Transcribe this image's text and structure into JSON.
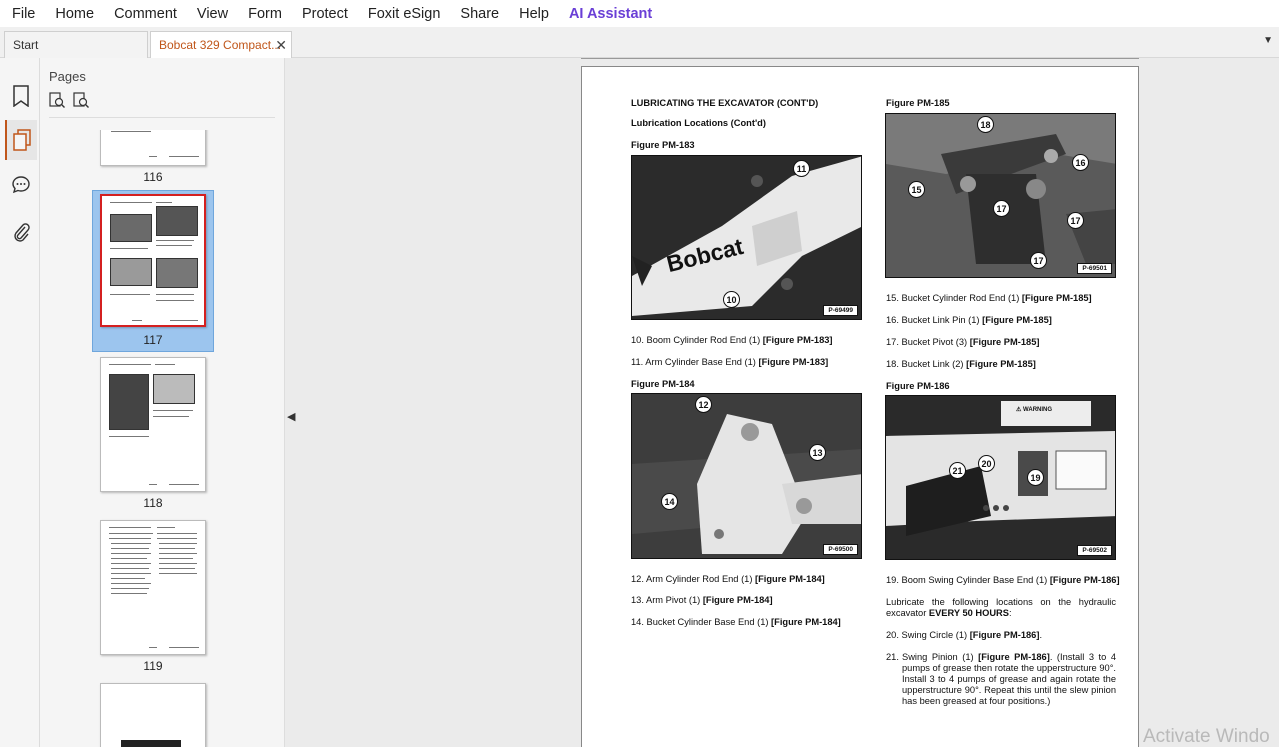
{
  "menu": [
    "File",
    "Home",
    "Comment",
    "View",
    "Form",
    "Protect",
    "Foxit eSign",
    "Share",
    "Help",
    "AI Assistant"
  ],
  "tabs": {
    "start": "Start",
    "document": "Bobcat 329 Compact..."
  },
  "panel": {
    "title": "Pages"
  },
  "thumbnails": [
    "116",
    "117",
    "118",
    "119"
  ],
  "page": {
    "heading": "LUBRICATING THE EXCAVATOR (CONT'D)",
    "subheading": "Lubrication Locations (Cont'd)",
    "fig183": {
      "caption": "Figure PM-183",
      "tag": "P-69499",
      "brand": "Bobcat"
    },
    "fig184": {
      "caption": "Figure PM-184",
      "tag": "P-69500"
    },
    "fig185": {
      "caption": "Figure PM-185",
      "tag": "P-69501"
    },
    "fig186": {
      "caption": "Figure PM-186",
      "tag": "P-69502",
      "warning": "⚠ WARNING"
    },
    "callouts": [
      "11",
      "10",
      "12",
      "13",
      "14",
      "18",
      "16",
      "15",
      "17",
      "17",
      "17",
      "21",
      "20",
      "19"
    ],
    "left_items": [
      {
        "text": "10. Boom Cylinder Rod End (1) ",
        "ref": "[Figure PM-183]"
      },
      {
        "text": "11. Arm Cylinder Base End (1) ",
        "ref": "[Figure PM-183]"
      },
      {
        "text": "12. Arm Cylinder Rod End (1) ",
        "ref": "[Figure PM-184]"
      },
      {
        "text": "13. Arm Pivot (1) ",
        "ref": "[Figure PM-184]"
      },
      {
        "text": "14. Bucket Cylinder Base End (1) ",
        "ref": "[Figure PM-184]"
      }
    ],
    "right_items": [
      {
        "text": "15. Bucket Cylinder Rod End (1) ",
        "ref": "[Figure PM-185]"
      },
      {
        "text": "16. Bucket Link Pin (1) ",
        "ref": "[Figure PM-185]"
      },
      {
        "text": "17. Bucket Pivot (3) ",
        "ref": "[Figure PM-185]"
      },
      {
        "text": "18. Bucket Link (2) ",
        "ref": "[Figure PM-185]"
      },
      {
        "text": "19. Boom Swing Cylinder Base End (1) ",
        "ref": "[Figure PM-186]"
      },
      {
        "text": "20. Swing Circle (1) ",
        "ref": "[Figure PM-186]",
        "suffix": "."
      }
    ],
    "lubricate_text": "Lubricate the following locations on the hydraulic excavator ",
    "lubricate_bold": "EVERY 50 HOURS",
    "lubricate_end": ":",
    "item21_num": "21.",
    "item21_a": "Swing Pinion (1) ",
    "item21_ref": "[Figure PM-186]",
    "item21_b": ". (Install 3 to 4 pumps of grease then rotate the upperstructure 90°. Install 3 to 4 pumps of grease and again rotate the upperstructure 90°. Repeat this until the slew pinion has been greased at four positions.)"
  },
  "watermark": "Activate Windo"
}
